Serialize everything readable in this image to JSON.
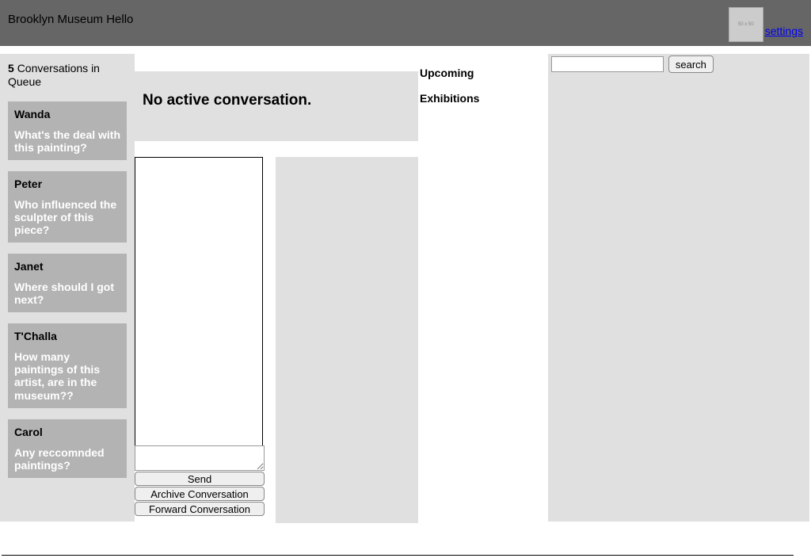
{
  "header": {
    "title": "Brooklyn Museum Hello",
    "avatar_label": "50 x 50",
    "settings_label": "settings"
  },
  "sidebar": {
    "count": "5",
    "label": "Conversations in Queue",
    "items": [
      {
        "name": "Wanda",
        "msg": "What's the deal with this painting?"
      },
      {
        "name": "Peter",
        "msg": "Who influenced the sculpter of this piece?"
      },
      {
        "name": "Janet",
        "msg": "Where should I got next?"
      },
      {
        "name": "T'Challa",
        "msg": "How many paintings of this artist, are in the museum??"
      },
      {
        "name": "Carol",
        "msg": "Any reccomnded paintings?"
      }
    ]
  },
  "conversation": {
    "heading": "No active conversation.",
    "send_label": "Send",
    "archive_label": "Archive Conversation",
    "forward_label": "Forward Conversation"
  },
  "upcoming": {
    "line1": "Upcoming",
    "line2": "Exhibitions"
  },
  "search": {
    "button_label": "search"
  }
}
